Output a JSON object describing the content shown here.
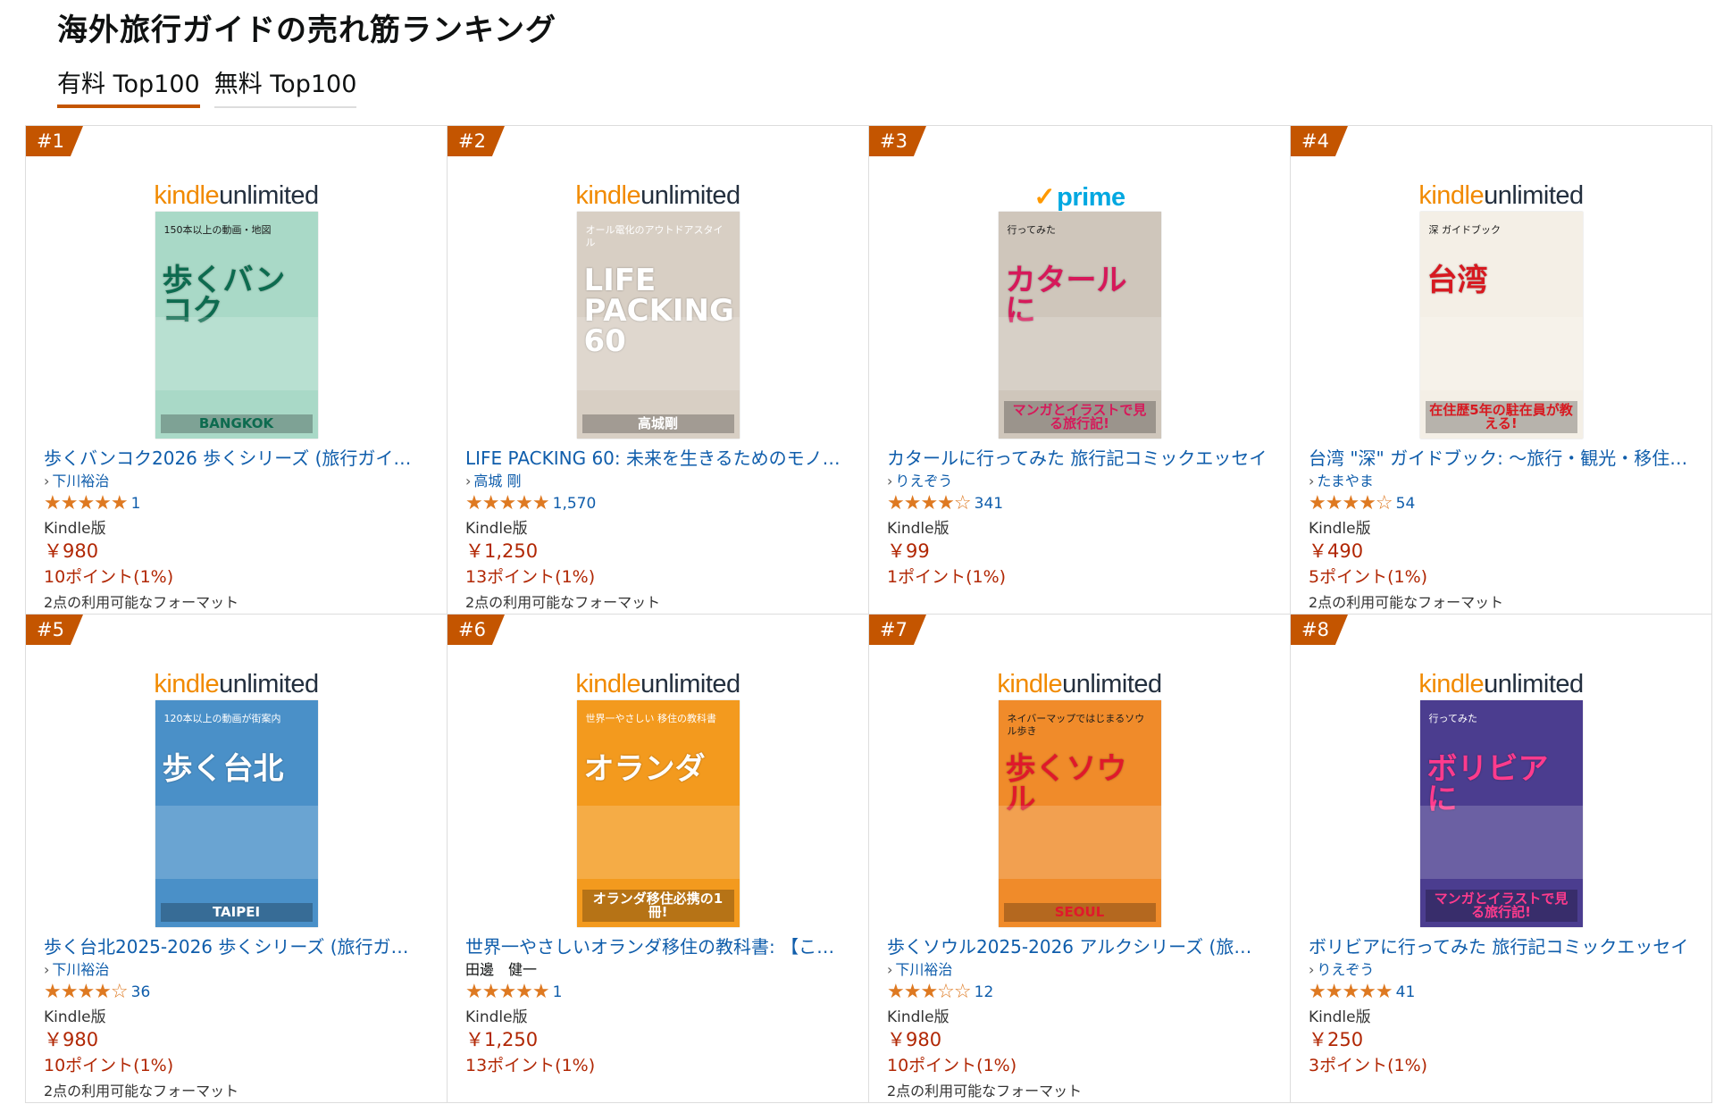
{
  "page": {
    "title": "海外旅行ガイドの売れ筋ランキング",
    "tabs": [
      {
        "label": "有料 Top100",
        "active": true
      },
      {
        "label": "無料 Top100",
        "active": false
      }
    ]
  },
  "colors": {
    "rank_bg": "#c45500",
    "link": "#0f5dab",
    "price": "#b12704",
    "star": "#de7921"
  },
  "products": [
    {
      "rank": "#1",
      "badge": "kindle-unlimited",
      "cover": {
        "big": "歩くバンコク",
        "small": "150本以上の動画・地図",
        "bottom": "BANGKOK",
        "bg": "#a9d9c7",
        "accent": "#0d6b4f"
      },
      "title": "歩くバンコク2026 歩くシリーズ (旅行ガイ…",
      "author": "下川裕治",
      "author_link": true,
      "stars": "★★★★★",
      "rating_count": "1",
      "format": "Kindle版",
      "price": "￥980",
      "points": "10ポイント(1%)",
      "formats": "2点の利用可能なフォーマット"
    },
    {
      "rank": "#2",
      "badge": "kindle-unlimited",
      "cover": {
        "big": "LIFE PACKING 60",
        "small": "オール電化のアウトドアスタイル",
        "bottom": "高城剛",
        "bg": "#d8cfc4",
        "accent": "#ffffff"
      },
      "title": "LIFE PACKING 60: 未来を生きるためのモノ…",
      "author": "高城 剛",
      "author_link": true,
      "stars": "★★★★★",
      "rating_count": "1,570",
      "format": "Kindle版",
      "price": "￥1,250",
      "points": "13ポイント(1%)",
      "formats": "2点の利用可能なフォーマット"
    },
    {
      "rank": "#3",
      "badge": "prime",
      "cover": {
        "big": "カタールに",
        "small": "行ってみた",
        "bottom": "マンガとイラストで見る旅行記!",
        "bg": "#cfc6bb",
        "accent": "#d6195a"
      },
      "title": "カタールに行ってみた 旅行記コミックエッセイ",
      "author": "りえぞう",
      "author_link": true,
      "stars": "★★★★☆",
      "rating_count": "341",
      "format": "Kindle版",
      "price": "￥99",
      "points": "1ポイント(1%)",
      "formats": ""
    },
    {
      "rank": "#4",
      "badge": "kindle-unlimited",
      "cover": {
        "big": "台湾",
        "small": "深 ガイドブック",
        "bottom": "在住歴5年の駐在員が教える!",
        "bg": "#f4efe6",
        "accent": "#d71920"
      },
      "title": "台湾 \"深\" ガイドブック: ～旅行・観光・移住…",
      "author": "たまやま",
      "author_link": true,
      "stars": "★★★★☆",
      "rating_count": "54",
      "format": "Kindle版",
      "price": "￥490",
      "points": "5ポイント(1%)",
      "formats": "2点の利用可能なフォーマット"
    },
    {
      "rank": "#5",
      "badge": "kindle-unlimited",
      "cover": {
        "big": "歩く台北",
        "small": "120本以上の動画が街案内",
        "bottom": "TAIPEI",
        "bg": "#4a90c8",
        "accent": "#ffffff"
      },
      "title": "歩く台北2025-2026 歩くシリーズ (旅行ガ…",
      "author": "下川裕治",
      "author_link": true,
      "stars": "★★★★☆",
      "rating_count": "36",
      "format": "Kindle版",
      "price": "￥980",
      "points": "10ポイント(1%)",
      "formats": "2点の利用可能なフォーマット"
    },
    {
      "rank": "#6",
      "badge": "kindle-unlimited",
      "cover": {
        "big": "オランダ",
        "small": "世界一やさしい 移住の教科書",
        "bottom": "オランダ移住必携の1冊!",
        "bg": "#f39a1e",
        "accent": "#ffffff"
      },
      "title": "世界一やさしいオランダ移住の教科書: 【こ…",
      "author": "田邊　健一",
      "author_link": false,
      "stars": "★★★★★",
      "rating_count": "1",
      "format": "Kindle版",
      "price": "￥1,250",
      "points": "13ポイント(1%)",
      "formats": ""
    },
    {
      "rank": "#7",
      "badge": "kindle-unlimited",
      "cover": {
        "big": "歩くソウル",
        "small": "ネイバーマップではじまるソウル歩き",
        "bottom": "SEOUL",
        "bg": "#f08b2a",
        "accent": "#e0192b"
      },
      "title": "歩くソウル2025-2026 アルクシリーズ (旅…",
      "author": "下川裕治",
      "author_link": true,
      "stars": "★★★☆☆",
      "rating_count": "12",
      "format": "Kindle版",
      "price": "￥980",
      "points": "10ポイント(1%)",
      "formats": "2点の利用可能なフォーマット"
    },
    {
      "rank": "#8",
      "badge": "kindle-unlimited",
      "cover": {
        "big": "ボリビアに",
        "small": "行ってみた",
        "bottom": "マンガとイラストで見る旅行記!",
        "bg": "#4b3d8f",
        "accent": "#ff3b8d"
      },
      "title": "ボリビアに行ってみた 旅行記コミックエッセイ",
      "author": "りえぞう",
      "author_link": true,
      "stars": "★★★★★",
      "rating_count": "41",
      "format": "Kindle版",
      "price": "￥250",
      "points": "3ポイント(1%)",
      "formats": ""
    }
  ]
}
